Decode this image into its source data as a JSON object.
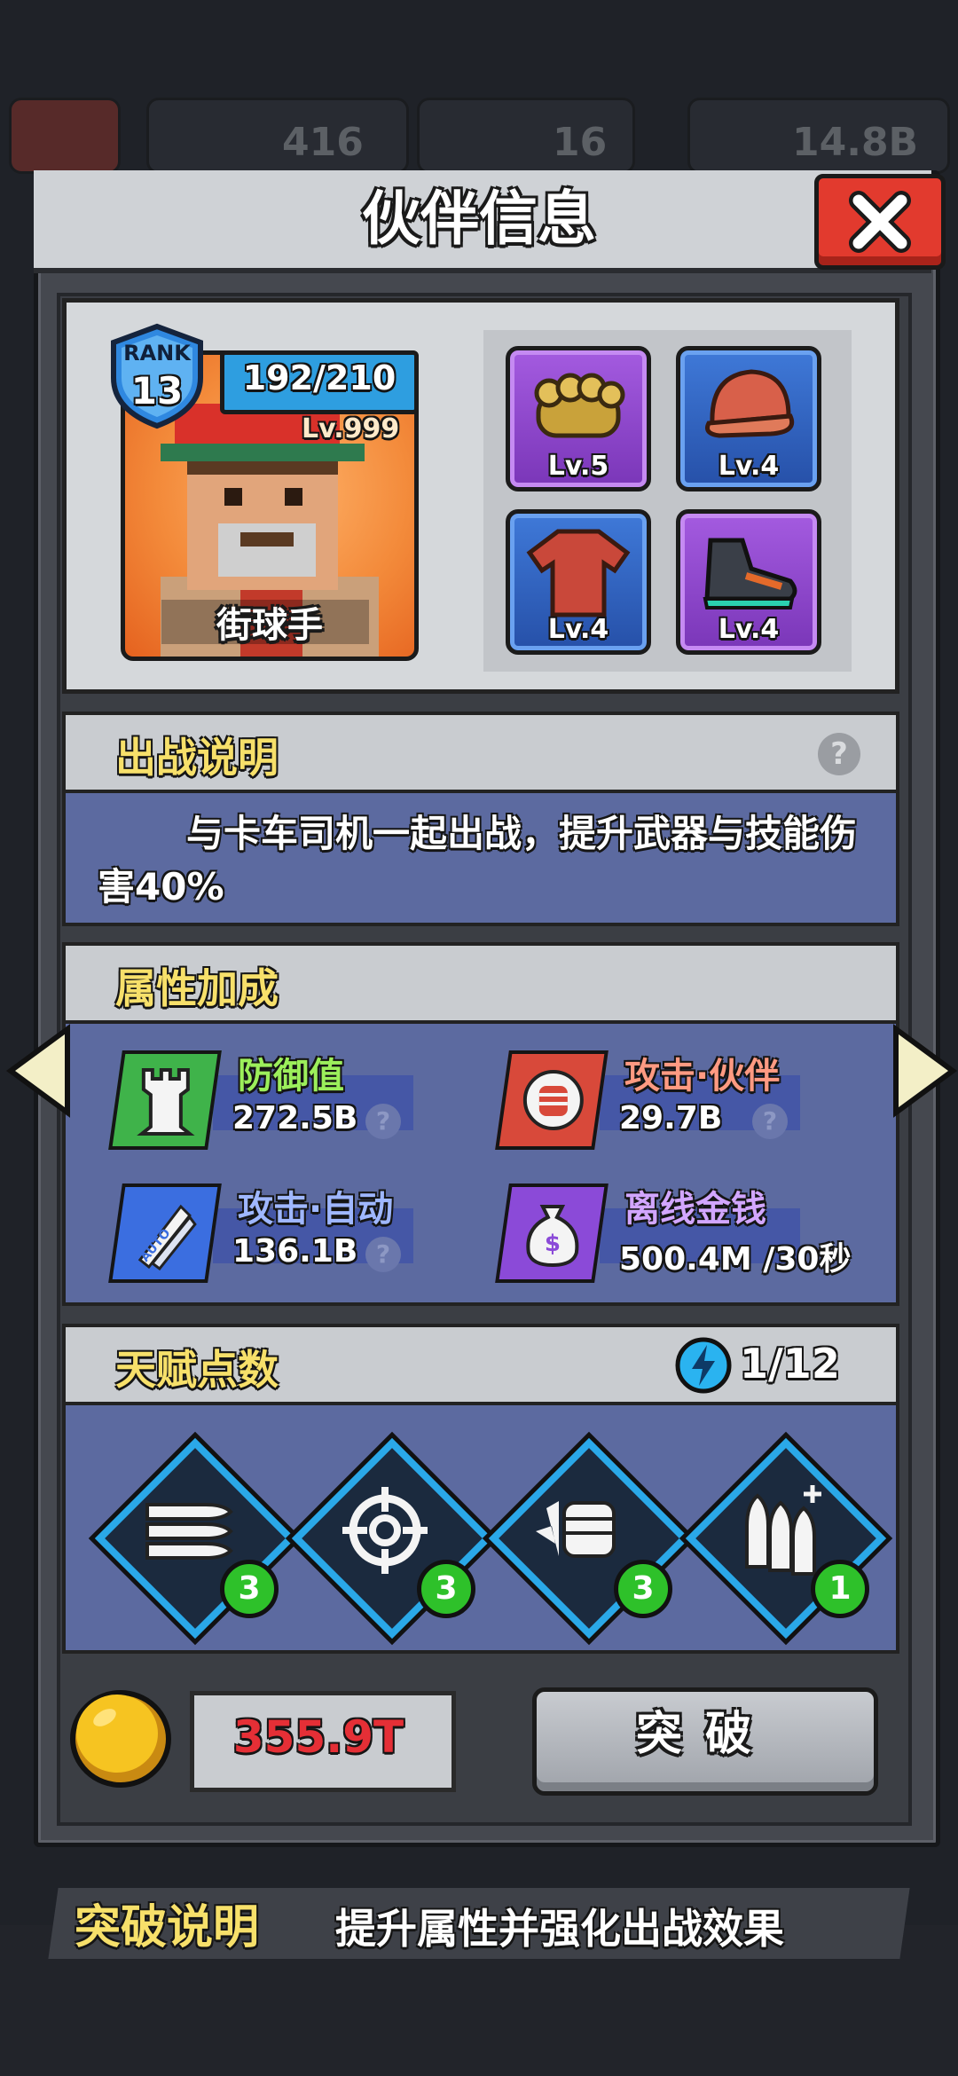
{
  "background": {
    "currencies": [
      {
        "icon": "green-gem-icon",
        "value": "416"
      },
      {
        "icon": "purple-gem-icon",
        "value": "16"
      },
      {
        "icon": "gold-coin-icon",
        "value": "14.8B"
      }
    ]
  },
  "modal": {
    "title": "伙伴信息",
    "hero": {
      "rank_label": "RANK",
      "rank_value": "13",
      "xp": "192/210",
      "level": "Lv.999",
      "name": "街球手"
    },
    "equipment": [
      {
        "item": "brass-knuckles-icon",
        "level": "Lv.5",
        "rarity": "purple"
      },
      {
        "item": "cap-icon",
        "level": "Lv.4",
        "rarity": "blue"
      },
      {
        "item": "tshirt-icon",
        "level": "Lv.4",
        "rarity": "blue"
      },
      {
        "item": "sneaker-icon",
        "level": "Lv.4",
        "rarity": "purple"
      }
    ],
    "battle": {
      "title": "出战说明",
      "description": "与卡车司机一起出战，提升武器与技能伤害40%"
    },
    "attributes": {
      "title": "属性加成",
      "items": [
        {
          "label": "防御值",
          "value": "272.5B",
          "icon": "tower-icon"
        },
        {
          "label": "攻击·伙伴",
          "value": "29.7B",
          "icon": "fist-icon"
        },
        {
          "label": "攻击·自动",
          "value": "136.1B",
          "icon": "auto-missile-icon"
        },
        {
          "label": "离线金钱",
          "value": "500.4M /30秒",
          "icon": "money-bag-icon"
        }
      ]
    },
    "talents": {
      "title": "天赋点数",
      "points": "1/12",
      "items": [
        {
          "icon": "bullets-icon",
          "count": "3"
        },
        {
          "icon": "crosshair-icon",
          "count": "3"
        },
        {
          "icon": "fist-icon",
          "count": "3"
        },
        {
          "icon": "bullets-plus-icon",
          "count": "1"
        }
      ]
    },
    "cost": "355.9T",
    "breakthrough_button": "突破"
  },
  "footer": {
    "title": "突破说明",
    "text": "提升属性并强化出战效果"
  },
  "colors": {
    "accent_yellow": "#f7e06a",
    "close_red": "#e23a2e",
    "cost_red": "#e52f36",
    "panel_blue": "#5c6aa0",
    "talent_green": "#2ec12a"
  }
}
